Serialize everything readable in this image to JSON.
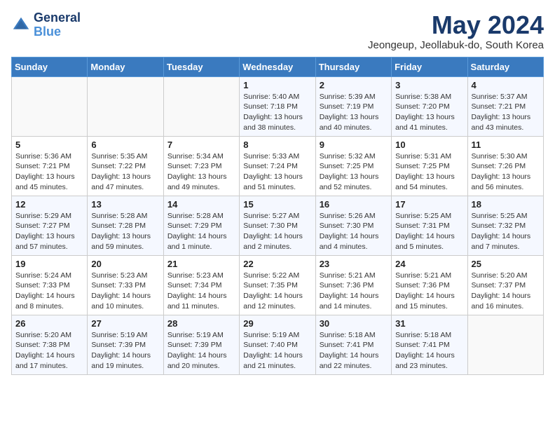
{
  "logo": {
    "general": "General",
    "blue": "Blue"
  },
  "title": {
    "month_year": "May 2024",
    "location": "Jeongeup, Jeollabuk-do, South Korea"
  },
  "days_of_week": [
    "Sunday",
    "Monday",
    "Tuesday",
    "Wednesday",
    "Thursday",
    "Friday",
    "Saturday"
  ],
  "weeks": [
    [
      {
        "day": "",
        "sunrise": "",
        "sunset": "",
        "daylight": ""
      },
      {
        "day": "",
        "sunrise": "",
        "sunset": "",
        "daylight": ""
      },
      {
        "day": "",
        "sunrise": "",
        "sunset": "",
        "daylight": ""
      },
      {
        "day": "1",
        "sunrise": "Sunrise: 5:40 AM",
        "sunset": "Sunset: 7:18 PM",
        "daylight": "Daylight: 13 hours and 38 minutes."
      },
      {
        "day": "2",
        "sunrise": "Sunrise: 5:39 AM",
        "sunset": "Sunset: 7:19 PM",
        "daylight": "Daylight: 13 hours and 40 minutes."
      },
      {
        "day": "3",
        "sunrise": "Sunrise: 5:38 AM",
        "sunset": "Sunset: 7:20 PM",
        "daylight": "Daylight: 13 hours and 41 minutes."
      },
      {
        "day": "4",
        "sunrise": "Sunrise: 5:37 AM",
        "sunset": "Sunset: 7:21 PM",
        "daylight": "Daylight: 13 hours and 43 minutes."
      }
    ],
    [
      {
        "day": "5",
        "sunrise": "Sunrise: 5:36 AM",
        "sunset": "Sunset: 7:21 PM",
        "daylight": "Daylight: 13 hours and 45 minutes."
      },
      {
        "day": "6",
        "sunrise": "Sunrise: 5:35 AM",
        "sunset": "Sunset: 7:22 PM",
        "daylight": "Daylight: 13 hours and 47 minutes."
      },
      {
        "day": "7",
        "sunrise": "Sunrise: 5:34 AM",
        "sunset": "Sunset: 7:23 PM",
        "daylight": "Daylight: 13 hours and 49 minutes."
      },
      {
        "day": "8",
        "sunrise": "Sunrise: 5:33 AM",
        "sunset": "Sunset: 7:24 PM",
        "daylight": "Daylight: 13 hours and 51 minutes."
      },
      {
        "day": "9",
        "sunrise": "Sunrise: 5:32 AM",
        "sunset": "Sunset: 7:25 PM",
        "daylight": "Daylight: 13 hours and 52 minutes."
      },
      {
        "day": "10",
        "sunrise": "Sunrise: 5:31 AM",
        "sunset": "Sunset: 7:25 PM",
        "daylight": "Daylight: 13 hours and 54 minutes."
      },
      {
        "day": "11",
        "sunrise": "Sunrise: 5:30 AM",
        "sunset": "Sunset: 7:26 PM",
        "daylight": "Daylight: 13 hours and 56 minutes."
      }
    ],
    [
      {
        "day": "12",
        "sunrise": "Sunrise: 5:29 AM",
        "sunset": "Sunset: 7:27 PM",
        "daylight": "Daylight: 13 hours and 57 minutes."
      },
      {
        "day": "13",
        "sunrise": "Sunrise: 5:28 AM",
        "sunset": "Sunset: 7:28 PM",
        "daylight": "Daylight: 13 hours and 59 minutes."
      },
      {
        "day": "14",
        "sunrise": "Sunrise: 5:28 AM",
        "sunset": "Sunset: 7:29 PM",
        "daylight": "Daylight: 14 hours and 1 minute."
      },
      {
        "day": "15",
        "sunrise": "Sunrise: 5:27 AM",
        "sunset": "Sunset: 7:30 PM",
        "daylight": "Daylight: 14 hours and 2 minutes."
      },
      {
        "day": "16",
        "sunrise": "Sunrise: 5:26 AM",
        "sunset": "Sunset: 7:30 PM",
        "daylight": "Daylight: 14 hours and 4 minutes."
      },
      {
        "day": "17",
        "sunrise": "Sunrise: 5:25 AM",
        "sunset": "Sunset: 7:31 PM",
        "daylight": "Daylight: 14 hours and 5 minutes."
      },
      {
        "day": "18",
        "sunrise": "Sunrise: 5:25 AM",
        "sunset": "Sunset: 7:32 PM",
        "daylight": "Daylight: 14 hours and 7 minutes."
      }
    ],
    [
      {
        "day": "19",
        "sunrise": "Sunrise: 5:24 AM",
        "sunset": "Sunset: 7:33 PM",
        "daylight": "Daylight: 14 hours and 8 minutes."
      },
      {
        "day": "20",
        "sunrise": "Sunrise: 5:23 AM",
        "sunset": "Sunset: 7:33 PM",
        "daylight": "Daylight: 14 hours and 10 minutes."
      },
      {
        "day": "21",
        "sunrise": "Sunrise: 5:23 AM",
        "sunset": "Sunset: 7:34 PM",
        "daylight": "Daylight: 14 hours and 11 minutes."
      },
      {
        "day": "22",
        "sunrise": "Sunrise: 5:22 AM",
        "sunset": "Sunset: 7:35 PM",
        "daylight": "Daylight: 14 hours and 12 minutes."
      },
      {
        "day": "23",
        "sunrise": "Sunrise: 5:21 AM",
        "sunset": "Sunset: 7:36 PM",
        "daylight": "Daylight: 14 hours and 14 minutes."
      },
      {
        "day": "24",
        "sunrise": "Sunrise: 5:21 AM",
        "sunset": "Sunset: 7:36 PM",
        "daylight": "Daylight: 14 hours and 15 minutes."
      },
      {
        "day": "25",
        "sunrise": "Sunrise: 5:20 AM",
        "sunset": "Sunset: 7:37 PM",
        "daylight": "Daylight: 14 hours and 16 minutes."
      }
    ],
    [
      {
        "day": "26",
        "sunrise": "Sunrise: 5:20 AM",
        "sunset": "Sunset: 7:38 PM",
        "daylight": "Daylight: 14 hours and 17 minutes."
      },
      {
        "day": "27",
        "sunrise": "Sunrise: 5:19 AM",
        "sunset": "Sunset: 7:39 PM",
        "daylight": "Daylight: 14 hours and 19 minutes."
      },
      {
        "day": "28",
        "sunrise": "Sunrise: 5:19 AM",
        "sunset": "Sunset: 7:39 PM",
        "daylight": "Daylight: 14 hours and 20 minutes."
      },
      {
        "day": "29",
        "sunrise": "Sunrise: 5:19 AM",
        "sunset": "Sunset: 7:40 PM",
        "daylight": "Daylight: 14 hours and 21 minutes."
      },
      {
        "day": "30",
        "sunrise": "Sunrise: 5:18 AM",
        "sunset": "Sunset: 7:41 PM",
        "daylight": "Daylight: 14 hours and 22 minutes."
      },
      {
        "day": "31",
        "sunrise": "Sunrise: 5:18 AM",
        "sunset": "Sunset: 7:41 PM",
        "daylight": "Daylight: 14 hours and 23 minutes."
      },
      {
        "day": "",
        "sunrise": "",
        "sunset": "",
        "daylight": ""
      }
    ]
  ]
}
